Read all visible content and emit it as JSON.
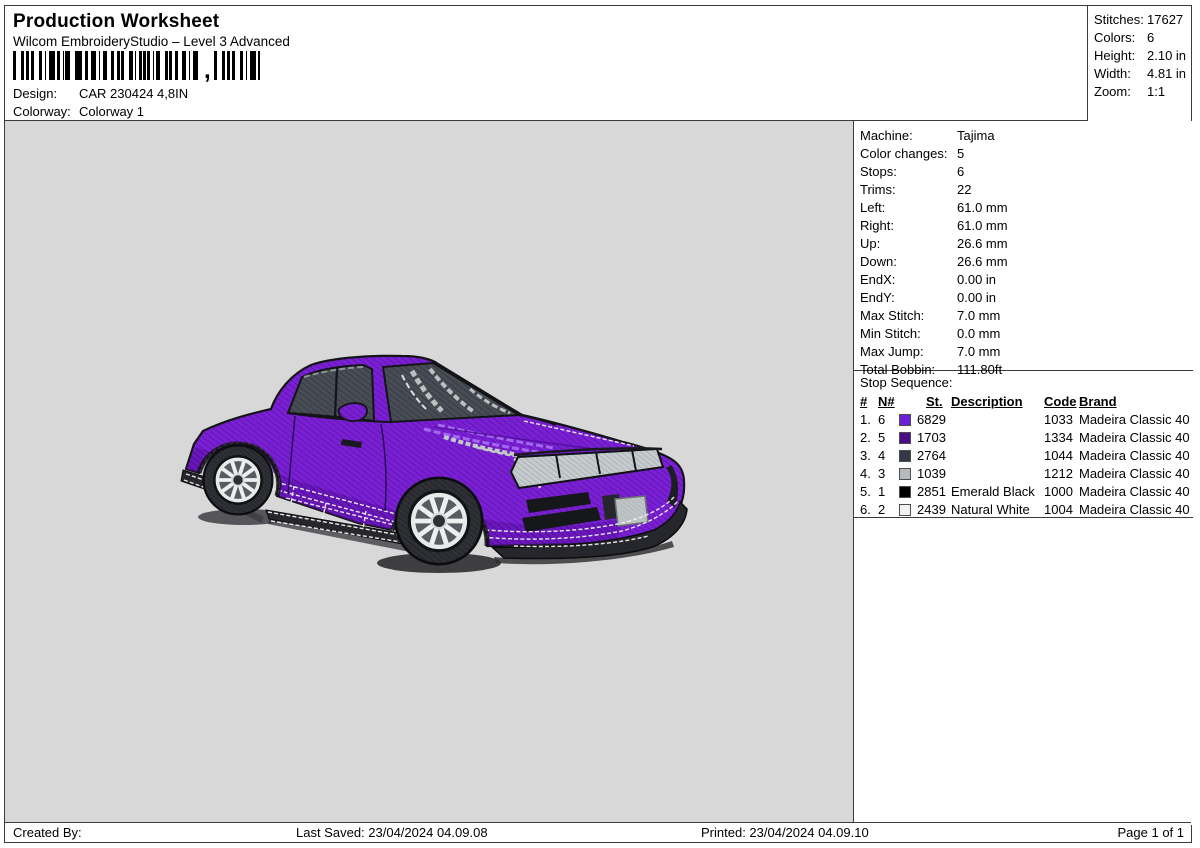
{
  "header": {
    "title": "Production Worksheet",
    "subtitle": "Wilcom EmbroideryStudio – Level 3 Advanced",
    "barcode_separator": ",",
    "design_label": "Design:",
    "design_value": "CAR 230424 4,8IN",
    "colorway_label": "Colorway:",
    "colorway_value": "Colorway 1"
  },
  "summary": {
    "rows": [
      {
        "label": "Stitches:",
        "value": "17627"
      },
      {
        "label": "Colors:",
        "value": "6"
      },
      {
        "label": "Height:",
        "value": "2.10 in"
      },
      {
        "label": "Width:",
        "value": "4.81 in"
      },
      {
        "label": "Zoom:",
        "value": "1:1"
      }
    ]
  },
  "machine": {
    "rows": [
      {
        "label": "Machine:",
        "value": "Tajima"
      },
      {
        "label": "Color changes:",
        "value": "5"
      },
      {
        "label": "Stops:",
        "value": "6"
      },
      {
        "label": "Trims:",
        "value": "22"
      },
      {
        "label": "Left:",
        "value": "61.0 mm"
      },
      {
        "label": "Right:",
        "value": "61.0 mm"
      },
      {
        "label": "Up:",
        "value": "26.6 mm"
      },
      {
        "label": "Down:",
        "value": "26.6 mm"
      },
      {
        "label": "EndX:",
        "value": "0.00 in"
      },
      {
        "label": "EndY:",
        "value": "0.00 in"
      },
      {
        "label": "Max Stitch:",
        "value": "7.0 mm"
      },
      {
        "label": "Min Stitch:",
        "value": "0.0 mm"
      },
      {
        "label": "Max Jump:",
        "value": "7.0 mm"
      },
      {
        "label": "Total Bobbin:",
        "value": "111.80ft"
      }
    ]
  },
  "stop_sequence": {
    "title": "Stop Sequence:",
    "columns": {
      "num": "#",
      "needle": "N#",
      "stitches": "St.",
      "description": "Description",
      "code": "Code",
      "brand": "Brand"
    },
    "rows": [
      {
        "num": "1.",
        "needle": "6",
        "swatch": "#6c1fd6",
        "stitches": "6829",
        "description": "",
        "code": "1033",
        "brand": "Madeira Classic 40"
      },
      {
        "num": "2.",
        "needle": "5",
        "swatch": "#4a0d88",
        "stitches": "1703",
        "description": "",
        "code": "1334",
        "brand": "Madeira Classic 40"
      },
      {
        "num": "3.",
        "needle": "4",
        "swatch": "#353847",
        "stitches": "2764",
        "description": "",
        "code": "1044",
        "brand": "Madeira Classic 40"
      },
      {
        "num": "4.",
        "needle": "3",
        "swatch": "#b5bbbd",
        "stitches": "1039",
        "description": "",
        "code": "1212",
        "brand": "Madeira Classic 40"
      },
      {
        "num": "5.",
        "needle": "1",
        "swatch": "#000000",
        "stitches": "2851",
        "description": "Emerald Black",
        "code": "1000",
        "brand": "Madeira Classic 40"
      },
      {
        "num": "6.",
        "needle": "2",
        "swatch": "#f2f2f2",
        "stitches": "2439",
        "description": "Natural White",
        "code": "1004",
        "brand": "Madeira Classic 40"
      }
    ]
  },
  "footer": {
    "created_by": "Created By:",
    "last_saved": "Last Saved: 23/04/2024 04.09.08",
    "printed": "Printed: 23/04/2024 04.09.10",
    "page": "Page 1 of 1"
  },
  "canvas": {
    "design_description": "purple sports coupe embroidery, front three-quarter view"
  },
  "colors": {
    "c-canvas": "#d8d8d8",
    "c-body": "#7a20d4",
    "c-bodyline": "#5a10a2",
    "c-bodydark": "#5a10a6",
    "c-bodydarkline": "#3c046e",
    "c-bodyhi": "#a76df0",
    "c-glass": "#474c55",
    "c-glassline": "#2f333a",
    "c-silver": "#c6cbce",
    "c-silverline": "#99a0a4",
    "c-tire": "#2e3036",
    "c-tireline": "#1b1d21",
    "c-plate": "#bfc5c7",
    "c-plateline": "#a6acaf",
    "c-stitchwhite": "#f1f1f1",
    "c-outline": "#141418",
    "c-shadow": "#2b2b30"
  }
}
